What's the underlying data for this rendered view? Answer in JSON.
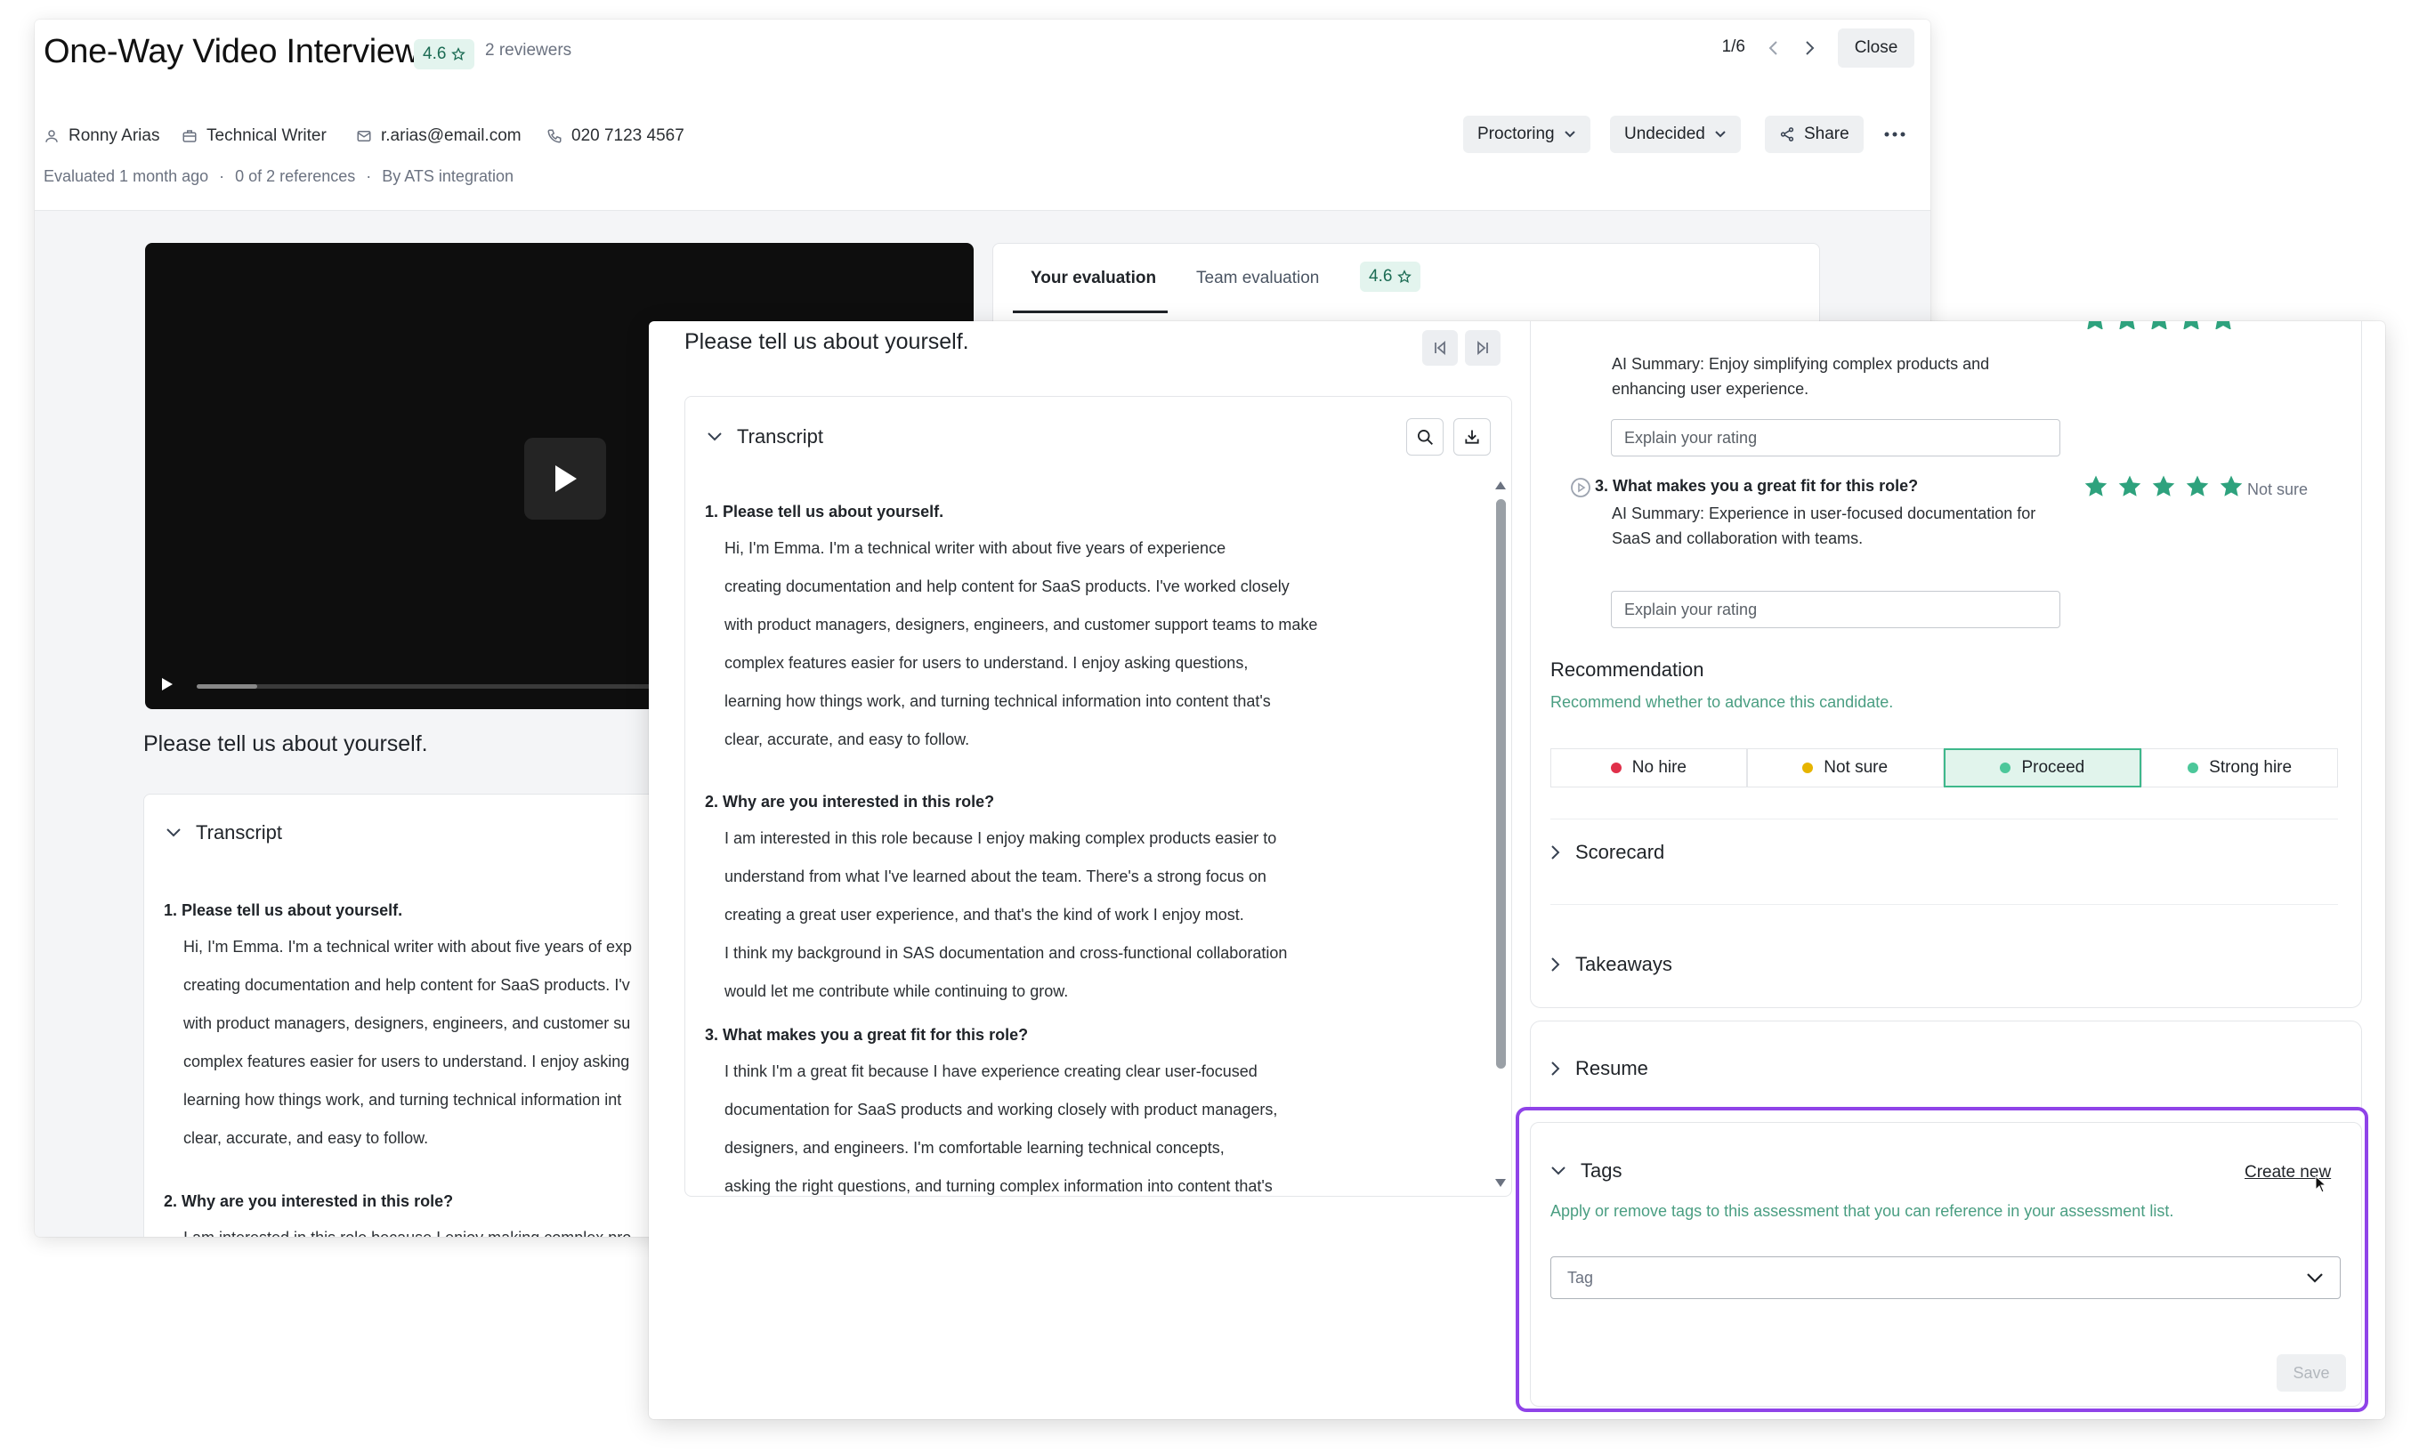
{
  "back": {
    "title": "One-Way Video Interview",
    "rating": "4.6",
    "reviewers": "2 reviewers",
    "pager": "1/6",
    "close": "Close",
    "candidate": {
      "name": "Ronny Arias",
      "role": "Technical Writer",
      "email": "r.arias@email.com",
      "phone": "020 7123 4567"
    },
    "meta": {
      "evaluated": "Evaluated 1 month ago",
      "references": "0 of 2 references",
      "source": "By ATS integration"
    },
    "buttons": {
      "proctoring": "Proctoring",
      "decision": "Undecided",
      "share": "Share"
    },
    "question": "Please tell us about yourself.",
    "tabs": {
      "your_eval": "Your evaluation",
      "team_eval": "Team evaluation",
      "team_rating": "4.6"
    },
    "transcript": {
      "heading": "Transcript",
      "q1": "1. Please tell us about yourself.",
      "q1_lines": [
        "Hi, I'm Emma. I'm a technical writer with about five years of exp",
        "creating documentation and help content for SaaS products. I'v",
        "with product managers, designers, engineers, and customer su",
        "complex features easier for users to understand. I enjoy asking",
        "learning how things work, and turning technical information int",
        "clear, accurate, and easy to follow."
      ],
      "q2": "2. Why are you interested in this role?",
      "q2_first": "I am interested in this role because I enjoy making complex pro"
    }
  },
  "front": {
    "question": "Please tell us about yourself.",
    "transcript": {
      "heading": "Transcript",
      "q1": "1. Please tell us about yourself.",
      "q1_lines": [
        "Hi, I'm Emma. I'm a technical writer with about five years of experience",
        "creating documentation and help content for SaaS products. I've worked closely",
        "with product managers, designers, engineers, and customer support teams to make",
        "complex features easier for users to understand. I enjoy asking questions,",
        "learning how things work, and turning technical information into content that's",
        "clear, accurate, and easy to follow."
      ],
      "q2": "2. Why are you interested in this role?",
      "q2_lines": [
        "I am interested in this role because I enjoy making complex products easier to",
        "understand from what I've learned about the team. There's a strong focus on",
        "creating a great user experience, and that's the kind of work I enjoy most.",
        "I think my background in SAS documentation and cross-functional collaboration",
        "would let me contribute while continuing to grow."
      ],
      "q3": "3. What makes you a great fit for this role?",
      "q3_lines": [
        "I think I'm a great fit because I have experience creating clear user-focused",
        "documentation for SaaS products and working closely with product managers,",
        "designers, and engineers. I'm comfortable learning technical concepts,",
        "asking the right questions, and turning complex information into content that's"
      ]
    },
    "evaluation": {
      "q2_summary": [
        "AI Summary: Enjoy simplifying complex products and",
        "enhancing user experience."
      ],
      "explain_placeholder": "Explain your rating",
      "q3_title": "3. What makes you a great fit for this role?",
      "q3_summary": [
        "AI Summary: Experience in user-focused documentation for",
        "SaaS and collaboration with teams."
      ],
      "q3_rating_stars": 5,
      "q3_rating_label": "Not sure",
      "recommendation_title": "Recommendation",
      "recommendation_desc": "Recommend whether to advance this candidate.",
      "recommendation_options": [
        {
          "label": "No hire",
          "color": "#e0304a"
        },
        {
          "label": "Not sure",
          "color": "#e6b400"
        },
        {
          "label": "Proceed",
          "color": "#4cc79a"
        },
        {
          "label": "Strong hire",
          "color": "#4cc79a"
        }
      ],
      "selected": "Proceed",
      "scorecard": "Scorecard",
      "takeaways": "Takeaways",
      "resume": "Resume"
    },
    "tags": {
      "title": "Tags",
      "create_new": "Create new",
      "description": "Apply or remove tags to this assessment that you can reference in your assessment list.",
      "select_placeholder": "Tag",
      "save": "Save"
    }
  },
  "colors": {
    "accent_green": "#2fa07b",
    "highlight_purple": "#8f43e8",
    "star_green": "#2ea27d"
  }
}
